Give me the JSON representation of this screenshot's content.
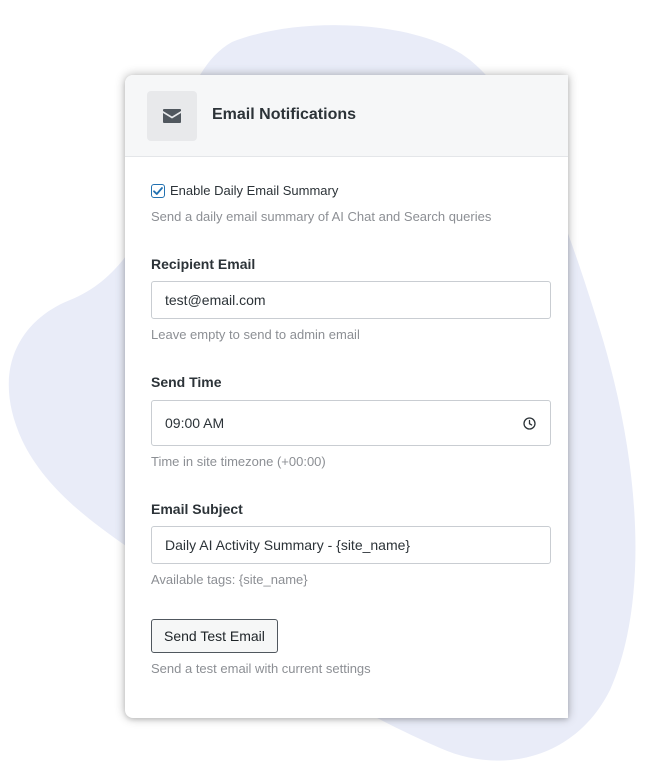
{
  "header": {
    "icon": "envelope-icon",
    "title": "Email Notifications"
  },
  "daily_summary": {
    "checked": true,
    "label": "Enable Daily Email Summary",
    "help": "Send a daily email summary of AI Chat and Search queries"
  },
  "recipient": {
    "label": "Recipient Email",
    "value": "test@email.com",
    "help": "Leave empty to send to admin email"
  },
  "send_time": {
    "label": "Send Time",
    "value": "09:00 AM",
    "icon": "clock-icon",
    "help": "Time in site timezone (+00:00)"
  },
  "subject": {
    "label": "Email Subject",
    "value": "Daily AI Activity Summary - {site_name}",
    "help": "Available tags: {site_name}"
  },
  "test_email": {
    "button_label": "Send Test Email",
    "help": "Send a test email with current settings"
  },
  "colors": {
    "accent": "#2271b1",
    "background_blob": "#e9ecf8",
    "text_primary": "#2c3338",
    "text_muted": "#8c8f94"
  }
}
